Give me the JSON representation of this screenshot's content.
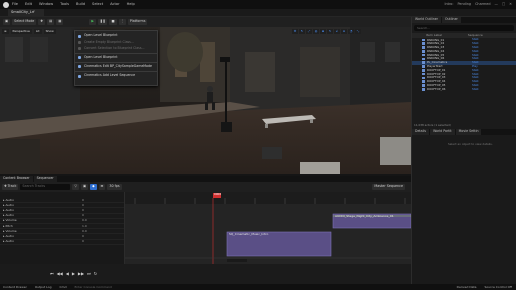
{
  "menu": {
    "items": [
      "File",
      "Edit",
      "Window",
      "Tools",
      "Build",
      "Select",
      "Actor",
      "Help"
    ],
    "project": "SmallCity_Lrf",
    "right": [
      "Intro:",
      "Pending",
      "Charmed"
    ]
  },
  "toolbar": {
    "mode": "Select Mode",
    "platforms": "Platforms",
    "settings": "Settings"
  },
  "viewport": {
    "perspective": "Perspective",
    "lit": "Lit",
    "show": "Show",
    "counter": "5"
  },
  "dropdown": {
    "items": [
      {
        "label": "Open Level Blueprint",
        "dim": false
      },
      {
        "label": "Create Empty Blueprint Class...",
        "dim": true
      },
      {
        "label": "Convert Selection to Blueprint Class...",
        "dim": true
      },
      {
        "label": "Open Level Blueprint",
        "dim": false
      },
      {
        "label": "Cinematics  Edit BP_CitySampleGameMode",
        "dim": false
      },
      {
        "label": "Cinematics  Add Level Sequence",
        "dim": false
      }
    ]
  },
  "outliner": {
    "tabs": [
      "World Outliner",
      "Outliner"
    ],
    "search": "Search...",
    "col_label": "Item Label",
    "col_type": "Sequence",
    "rows": [
      {
        "label": "PARKING_01",
        "type": "Stati"
      },
      {
        "label": "PARKING_02",
        "type": "Stati"
      },
      {
        "label": "PARKING_03",
        "type": "Stati"
      },
      {
        "label": "PARKING_04",
        "type": "Stati"
      },
      {
        "label": "PARKING_05",
        "type": "Stati"
      },
      {
        "label": "PARKING_06",
        "type": "Stati"
      },
      {
        "label": "PL_Cinematics",
        "type": "Stati"
      },
      {
        "label": "PlayerStart",
        "type": "Play"
      },
      {
        "label": "ROOFTOP_01",
        "type": "Stati"
      },
      {
        "label": "ROOFTOP_02",
        "type": "Stati"
      },
      {
        "label": "ROOFTOP_03",
        "type": "Stati"
      },
      {
        "label": "ROOFTOP_04",
        "type": "Stati"
      },
      {
        "label": "ROOFTOP_05",
        "type": "Stati"
      },
      {
        "label": "ROOFTOP_06",
        "type": "Stati"
      }
    ],
    "footer": "11,038 actors (1 selected)"
  },
  "details": {
    "tabs": [
      "Details",
      "World Partit",
      "Movie Settin"
    ],
    "hint": "Select an object to view details."
  },
  "content": {
    "tabs": [
      "Content Browser",
      "Sequencer"
    ]
  },
  "sequencer": {
    "track_btn": "Track",
    "search": "Search Tracks",
    "fps": "30 fps",
    "seq_name": "Master Sequence",
    "tracks": [
      {
        "label": "Audio",
        "val": "0"
      },
      {
        "label": "Audio",
        "val": "0"
      },
      {
        "label": "Audio",
        "val": "0"
      },
      {
        "label": "Audio",
        "val": "0"
      },
      {
        "label": "Volume",
        "val": "0.0"
      },
      {
        "label": "Pitch",
        "val": "1.0"
      },
      {
        "label": "Volume",
        "val": "0.0"
      },
      {
        "label": "Audio",
        "val": "0"
      },
      {
        "label": "Audio",
        "val": "0"
      }
    ],
    "section1": "SQ_Cinematic_Music_Intro",
    "section2": "AUDIO_Stage_Night_City_Ambience_01",
    "timecode": "0000"
  },
  "statusbar": {
    "items": [
      "Content Drawer",
      "Output Log",
      "Cmd",
      "Enter Console Command"
    ],
    "right": [
      "Derived Data",
      "Source Control Off"
    ]
  }
}
